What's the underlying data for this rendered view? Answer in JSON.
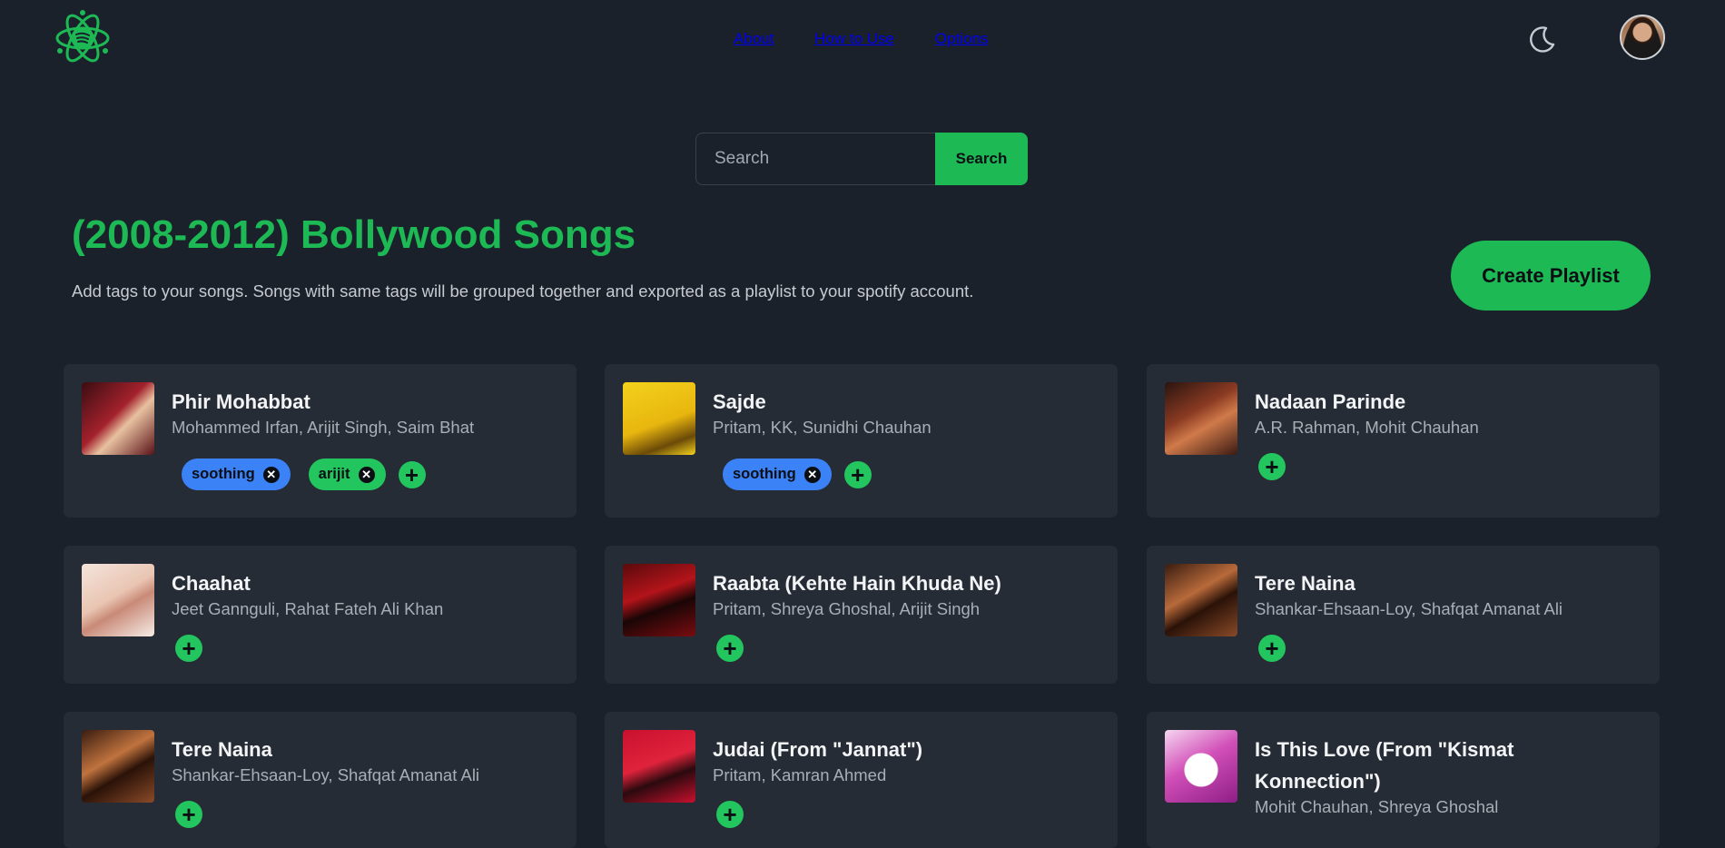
{
  "nav": {
    "items": [
      "About",
      "How to Use",
      "Options"
    ]
  },
  "search": {
    "placeholder": "Search",
    "button_label": "Search"
  },
  "page": {
    "title": "(2008-2012) Bollywood Songs",
    "subtitle": "Add tags to your songs. Songs with same tags will be grouped together and exported as a playlist to your spotify account.",
    "create_button": "Create Playlist"
  },
  "songs": [
    {
      "title": "Phir Mohabbat",
      "artists": "Mohammed Irfan, Arijit Singh, Saim Bhat",
      "tags": [
        "soothing",
        "arijit"
      ]
    },
    {
      "title": "Sajde",
      "artists": "Pritam, KK, Sunidhi Chauhan",
      "tags": [
        "soothing"
      ]
    },
    {
      "title": "Nadaan Parinde",
      "artists": "A.R. Rahman, Mohit Chauhan",
      "tags": []
    },
    {
      "title": "Chaahat",
      "artists": "Jeet Gannguli, Rahat Fateh Ali Khan",
      "tags": []
    },
    {
      "title": "Raabta (Kehte Hain Khuda Ne)",
      "artists": "Pritam, Shreya Ghoshal, Arijit Singh",
      "tags": []
    },
    {
      "title": "Tere Naina",
      "artists": "Shankar-Ehsaan-Loy, Shafqat Amanat Ali",
      "tags": []
    },
    {
      "title": "Tere Naina",
      "artists": "Shankar-Ehsaan-Loy, Shafqat Amanat Ali",
      "tags": []
    },
    {
      "title": "Judai (From \"Jannat\")",
      "artists": "Pritam, Kamran Ahmed",
      "tags": []
    },
    {
      "title": "Is This Love (From \"Kismat Konnection\")",
      "artists": "Mohit Chauhan, Shreya Ghoshal",
      "tags": []
    }
  ],
  "colors": {
    "accent": "#1db954",
    "tag_blue": "#3b82f6",
    "tag_green": "#22c55e",
    "background": "#1b212b",
    "card": "#262c36"
  },
  "icons": {
    "logo": "spotify-atom-logo",
    "theme": "moon-icon",
    "add": "plus-icon",
    "remove": "close-icon"
  }
}
